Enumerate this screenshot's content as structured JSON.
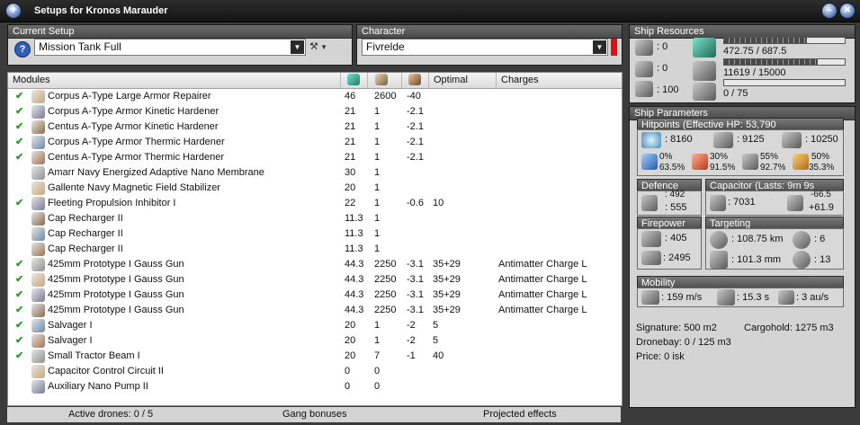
{
  "window": {
    "title": "Setups for Kronos Marauder"
  },
  "current_setup": {
    "header": "Current Setup",
    "value": "Mission Tank Full"
  },
  "character": {
    "header": "Character",
    "value": "Fivrelde"
  },
  "modules": {
    "columns": {
      "name": "Modules",
      "optimal": "Optimal",
      "charges": "Charges"
    },
    "rows": [
      {
        "check": "✔",
        "name": "Corpus A-Type Large Armor Repairer",
        "cpu": "46",
        "pg": "2600",
        "cap": "-40",
        "optimal": "",
        "charge": ""
      },
      {
        "check": "✔",
        "name": "Corpus A-Type Armor Kinetic Hardener",
        "cpu": "21",
        "pg": "1",
        "cap": "-2.1",
        "optimal": "",
        "charge": ""
      },
      {
        "check": "✔",
        "name": "Centus A-Type Armor Kinetic Hardener",
        "cpu": "21",
        "pg": "1",
        "cap": "-2.1",
        "optimal": "",
        "charge": ""
      },
      {
        "check": "✔",
        "name": "Corpus A-Type Armor Thermic Hardener",
        "cpu": "21",
        "pg": "1",
        "cap": "-2.1",
        "optimal": "",
        "charge": ""
      },
      {
        "check": "✔",
        "name": "Centus A-Type Armor Thermic Hardener",
        "cpu": "21",
        "pg": "1",
        "cap": "-2.1",
        "optimal": "",
        "charge": ""
      },
      {
        "check": "",
        "name": "Amarr Navy Energized Adaptive Nano Membrane",
        "cpu": "30",
        "pg": "1",
        "cap": "",
        "optimal": "",
        "charge": ""
      },
      {
        "check": "",
        "name": "Gallente Navy Magnetic Field Stabilizer",
        "cpu": "20",
        "pg": "1",
        "cap": "",
        "optimal": "",
        "charge": ""
      },
      {
        "check": "✔",
        "name": "Fleeting Propulsion Inhibitor I",
        "cpu": "22",
        "pg": "1",
        "cap": "-0.6",
        "optimal": "10",
        "charge": ""
      },
      {
        "check": "",
        "name": "Cap Recharger II",
        "cpu": "11.3",
        "pg": "1",
        "cap": "",
        "optimal": "",
        "charge": ""
      },
      {
        "check": "",
        "name": "Cap Recharger II",
        "cpu": "11.3",
        "pg": "1",
        "cap": "",
        "optimal": "",
        "charge": ""
      },
      {
        "check": "",
        "name": "Cap Recharger II",
        "cpu": "11.3",
        "pg": "1",
        "cap": "",
        "optimal": "",
        "charge": ""
      },
      {
        "check": "✔",
        "name": "425mm Prototype I Gauss Gun",
        "cpu": "44.3",
        "pg": "2250",
        "cap": "-3.1",
        "optimal": "35+29",
        "charge": "Antimatter Charge L"
      },
      {
        "check": "✔",
        "name": "425mm Prototype I Gauss Gun",
        "cpu": "44.3",
        "pg": "2250",
        "cap": "-3.1",
        "optimal": "35+29",
        "charge": "Antimatter Charge L"
      },
      {
        "check": "✔",
        "name": "425mm Prototype I Gauss Gun",
        "cpu": "44.3",
        "pg": "2250",
        "cap": "-3.1",
        "optimal": "35+29",
        "charge": "Antimatter Charge L"
      },
      {
        "check": "✔",
        "name": "425mm Prototype I Gauss Gun",
        "cpu": "44.3",
        "pg": "2250",
        "cap": "-3.1",
        "optimal": "35+29",
        "charge": "Antimatter Charge L"
      },
      {
        "check": "✔",
        "name": "Salvager I",
        "cpu": "20",
        "pg": "1",
        "cap": "-2",
        "optimal": "5",
        "charge": ""
      },
      {
        "check": "✔",
        "name": "Salvager I",
        "cpu": "20",
        "pg": "1",
        "cap": "-2",
        "optimal": "5",
        "charge": ""
      },
      {
        "check": "✔",
        "name": "Small Tractor Beam I",
        "cpu": "20",
        "pg": "7",
        "cap": "-1",
        "optimal": "40",
        "charge": ""
      },
      {
        "check": "",
        "name": "Capacitor Control Circuit II",
        "cpu": "0",
        "pg": "0",
        "cap": "",
        "optimal": "",
        "charge": ""
      },
      {
        "check": "",
        "name": "Auxiliary Nano Pump II",
        "cpu": "0",
        "pg": "0",
        "cap": "",
        "optimal": "",
        "charge": ""
      }
    ]
  },
  "statusbar": {
    "drones": "Active drones: 0 / 5",
    "gang": "Gang bonuses",
    "projected": "Projected effects"
  },
  "ship_resources": {
    "header": "Ship Resources",
    "hardpoints": {
      "turret": ": 0",
      "launcher": ": 0",
      "calibration": ": 100"
    },
    "cpu": {
      "text": "472.75 / 687.5",
      "fraction": 0.688
    },
    "powergrid": {
      "text": "11619 / 15000",
      "fraction": 0.775
    },
    "drone_bandwidth": {
      "text": "0 / 75",
      "fraction": 0
    }
  },
  "ship_parameters": {
    "header": "Ship Parameters",
    "hitpoints": {
      "header": "Hitpoints (Effective HP: 53,790",
      "shield": ": 8160",
      "armor": ": 9125",
      "hull": ": 10250",
      "resists": [
        {
          "top": "0%",
          "bottom": "63.5%"
        },
        {
          "top": "30%",
          "bottom": "91.5%"
        },
        {
          "top": "55%",
          "bottom": "92.7%"
        },
        {
          "top": "50%",
          "bottom": "35.3%"
        }
      ]
    },
    "defence": {
      "header": "Defence",
      "top": ": 492",
      "bottom": ": 555"
    },
    "capacitor": {
      "header": "Capacitor (Lasts: 9m 9s",
      "amount": ": 7031",
      "top": "-66.5",
      "bottom": "+61.9"
    },
    "firepower": {
      "header": "Firepower",
      "top": ": 405",
      "bottom": ": 2495"
    },
    "targeting": {
      "header": "Targeting",
      "range": ": 108.75 km",
      "targets": ": 6",
      "resolution": ": 101.3 mm",
      "sensor": ": 13"
    },
    "mobility": {
      "header": "Mobility",
      "speed": ": 159 m/s",
      "align": ": 15.3 s",
      "warp": ": 3 au/s"
    },
    "info": {
      "signature": "Signature: 500 m2",
      "cargohold": "Cargohold: 1275 m3",
      "dronebay": "Dronebay: 0 / 125 m3",
      "price": "Price: 0 isk"
    }
  }
}
